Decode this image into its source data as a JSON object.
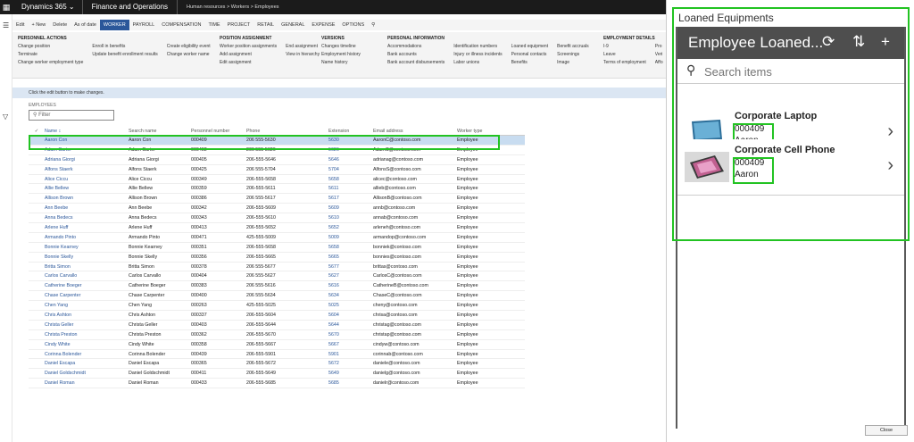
{
  "topnav": {
    "brand": "Dynamics 365",
    "module": "Finance and Operations",
    "breadcrumb": "Human resources  >  Workers  >  Employees"
  },
  "toolbar": [
    "Edit",
    "+ New",
    "Delete",
    "As of date",
    "WORKER",
    "PAYROLL",
    "COMPENSATION",
    "TIME",
    "PROJECT",
    "RETAIL",
    "GENERAL",
    "EXPENSE",
    "OPTIONS"
  ],
  "ribbon": {
    "personnel": {
      "head": "PERSONNEL ACTIONS",
      "col1": [
        "Change position",
        "Terminate",
        "Change worker employment type"
      ],
      "col2": [
        "Enroll in benefits",
        "Update benefit enrollment results"
      ],
      "col3": [
        "Create eligibility event",
        "Change worker name"
      ]
    },
    "position": {
      "head": "POSITION ASSIGNMENT",
      "col1": [
        "Worker position assignments",
        "Add assignment",
        "Edit assignment"
      ],
      "col2": [
        "End assignment",
        "View in hierarchy"
      ]
    },
    "versions": {
      "head": "VERSIONS",
      "col1": [
        "Changes timeline",
        "Employment history",
        "Name history"
      ]
    },
    "personal": {
      "head": "PERSONAL INFORMATION",
      "col1": [
        "Accommodations",
        "Bank accounts",
        "Bank account disbursements"
      ],
      "col2": [
        "Identification numbers",
        "Injury or illness incidents",
        "Labor unions"
      ],
      "col3": [
        "Loaned equipment",
        "Personal contacts",
        "Benefits"
      ],
      "col4": [
        "Benefit accruals",
        "Screenings",
        "Image"
      ]
    },
    "employment": {
      "head": "EMPLOYMENT DETAILS",
      "col1": [
        "I-9",
        "Leave",
        "Terms of employment"
      ],
      "col2": [
        "Pro",
        "Veri",
        "Affo"
      ]
    }
  },
  "infobar": "Click the edit button to make changes.",
  "employees_label": "EMPLOYEES",
  "filter_placeholder": "Filter",
  "grid": {
    "headers": [
      "Name",
      "Search name",
      "Personnel number",
      "Phone",
      "Extension",
      "Email address",
      "Worker type"
    ],
    "rows": [
      [
        "Aaron Con",
        "Aaron Con",
        "000409",
        "206 555-5630",
        "5630",
        "AaronC@contoso.com",
        "Employee"
      ],
      [
        "Adam Carter",
        "Adam Carter",
        "000402",
        "206 555-5626",
        "5626",
        "AdamC@contoso.com",
        "Employee"
      ],
      [
        "Adriana Giorgi",
        "Adriana Giorgi",
        "000405",
        "206-555-5646",
        "5646",
        "adrianag@contoso.com",
        "Employee"
      ],
      [
        "Alfons Staerk",
        "Alfons Staerk",
        "000425",
        "206 555-5704",
        "5704",
        "AlfonsS@contoso.com",
        "Employee"
      ],
      [
        "Alice Ciccu",
        "Alice Ciccu",
        "000349",
        "206-555-5658",
        "5658",
        "alicec@contoso.com",
        "Employee"
      ],
      [
        "Allie Bellew",
        "Allie Bellew",
        "000359",
        "206-555-5611",
        "5611",
        "allieb@contoso.com",
        "Employee"
      ],
      [
        "Allison Brown",
        "Allison Brown",
        "000386",
        "206 555-5617",
        "5617",
        "AllisonB@contoso.com",
        "Employee"
      ],
      [
        "Ann Beebe",
        "Ann Beebe",
        "000342",
        "206-555-5609",
        "5609",
        "annb@contoso.com",
        "Employee"
      ],
      [
        "Anna Bedecs",
        "Anna Bedecs",
        "000343",
        "206-555-5610",
        "5610",
        "annab@contoso.com",
        "Employee"
      ],
      [
        "Arlene Huff",
        "Arlene Huff",
        "000413",
        "206-555-5652",
        "5652",
        "arleneh@contoso.com",
        "Employee"
      ],
      [
        "Armando Pinto",
        "Armando Pinto",
        "000471",
        "425-555-5009",
        "5009",
        "armandop@contoso.com",
        "Employee"
      ],
      [
        "Bonnie Kearney",
        "Bonnie Kearney",
        "000351",
        "206-555-5658",
        "5658",
        "bonniek@contoso.com",
        "Employee"
      ],
      [
        "Bonnie Skelly",
        "Bonnie Skelly",
        "000356",
        "206-555-5665",
        "5665",
        "bonnies@contoso.com",
        "Employee"
      ],
      [
        "Britta Simon",
        "Britta Simon",
        "000378",
        "206 555-5677",
        "5677",
        "brittas@contoso.com",
        "Employee"
      ],
      [
        "Carlos Carvallo",
        "Carlos Carvallo",
        "000404",
        "206 555-5627",
        "5627",
        "CarlosC@contoso.com",
        "Employee"
      ],
      [
        "Catherine Boeger",
        "Catherine Boeger",
        "000383",
        "206 555-5616",
        "5616",
        "CatherineB@contoso.com",
        "Employee"
      ],
      [
        "Chase Carpenter",
        "Chase Carpenter",
        "000400",
        "206 555-5634",
        "5634",
        "ChaseC@contoso.com",
        "Employee"
      ],
      [
        "Chen Yang",
        "Chen Yang",
        "000263",
        "425-555-5025",
        "5025",
        "cheny@contoso.com",
        "Employee"
      ],
      [
        "Chris Ashton",
        "Chris Ashton",
        "000337",
        "206-555-5604",
        "5604",
        "chrisa@contoso.com",
        "Employee"
      ],
      [
        "Christa Geller",
        "Christa Geller",
        "000403",
        "206-555-5644",
        "5644",
        "christag@contoso.com",
        "Employee"
      ],
      [
        "Christa Preston",
        "Christa Preston",
        "000362",
        "206-555-5670",
        "5670",
        "christap@contoso.com",
        "Employee"
      ],
      [
        "Cindy White",
        "Cindy White",
        "000358",
        "206-555-5667",
        "5667",
        "cindyw@contoso.com",
        "Employee"
      ],
      [
        "Corinna Bolender",
        "Corinna Bolender",
        "000439",
        "206-555-5901",
        "5901",
        "corinnab@contoso.com",
        "Employee"
      ],
      [
        "Daniel Escapa",
        "Daniel Escapa",
        "000365",
        "206-555-5672",
        "5672",
        "daniele@contoso.com",
        "Employee"
      ],
      [
        "Daniel Goldschmidt",
        "Daniel Goldschmidt",
        "000411",
        "206-555-5649",
        "5649",
        "danielg@contoso.com",
        "Employee"
      ],
      [
        "Daniel Roman",
        "Daniel Roman",
        "000433",
        "206-555-5685",
        "5685",
        "danielr@contoso.com",
        "Employee"
      ]
    ]
  },
  "panel": {
    "title": "Loaned Equipments",
    "app_title": "Employee Loaned...",
    "search_placeholder": "Search items",
    "items": [
      {
        "name": "Corporate Laptop",
        "number": "000409",
        "user": "Aaron"
      },
      {
        "name": "Corporate Cell Phone",
        "number": "000409",
        "user": "Aaron"
      }
    ]
  },
  "close_label": "Close",
  "colors": {
    "accent": "#2b579a",
    "highlight": "#22c322",
    "nav": "#1b1b1b",
    "app_header": "#4e4e4e"
  }
}
